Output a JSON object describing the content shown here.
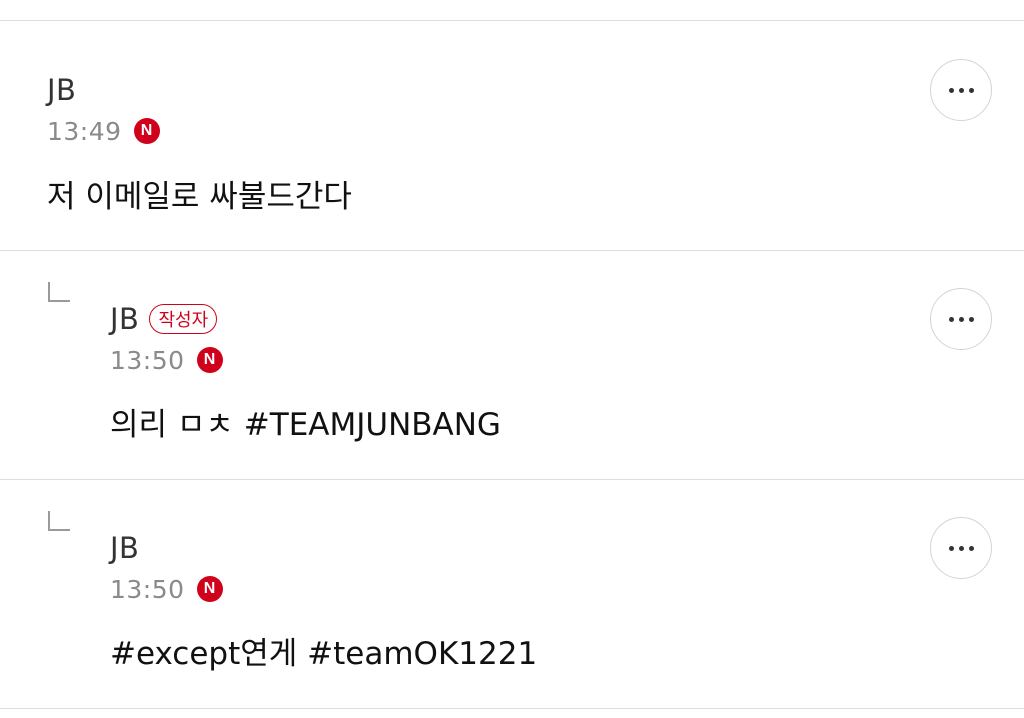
{
  "comments": [
    {
      "author": "JB",
      "author_badge": "",
      "time": "13:49",
      "source_icon": "naver-n-icon",
      "source_letter": "N",
      "text": "저 이메일로 싸불드간다",
      "is_reply": false
    },
    {
      "author": "JB",
      "author_badge": "작성자",
      "time": "13:50",
      "source_icon": "naver-n-icon",
      "source_letter": "N",
      "text": "의리 ㅁㅊ #TEAMJUNBANG",
      "is_reply": true
    },
    {
      "author": "JB",
      "author_badge": "",
      "time": "13:50",
      "source_icon": "naver-n-icon",
      "source_letter": "N",
      "text": "#except연게 #teamOK1221",
      "is_reply": true
    }
  ],
  "more_button_icon": "more-horizontal-icon",
  "colors": {
    "accent_red": "#d0021b",
    "divider": "#dedede",
    "meta_gray": "#8a8a8a"
  }
}
